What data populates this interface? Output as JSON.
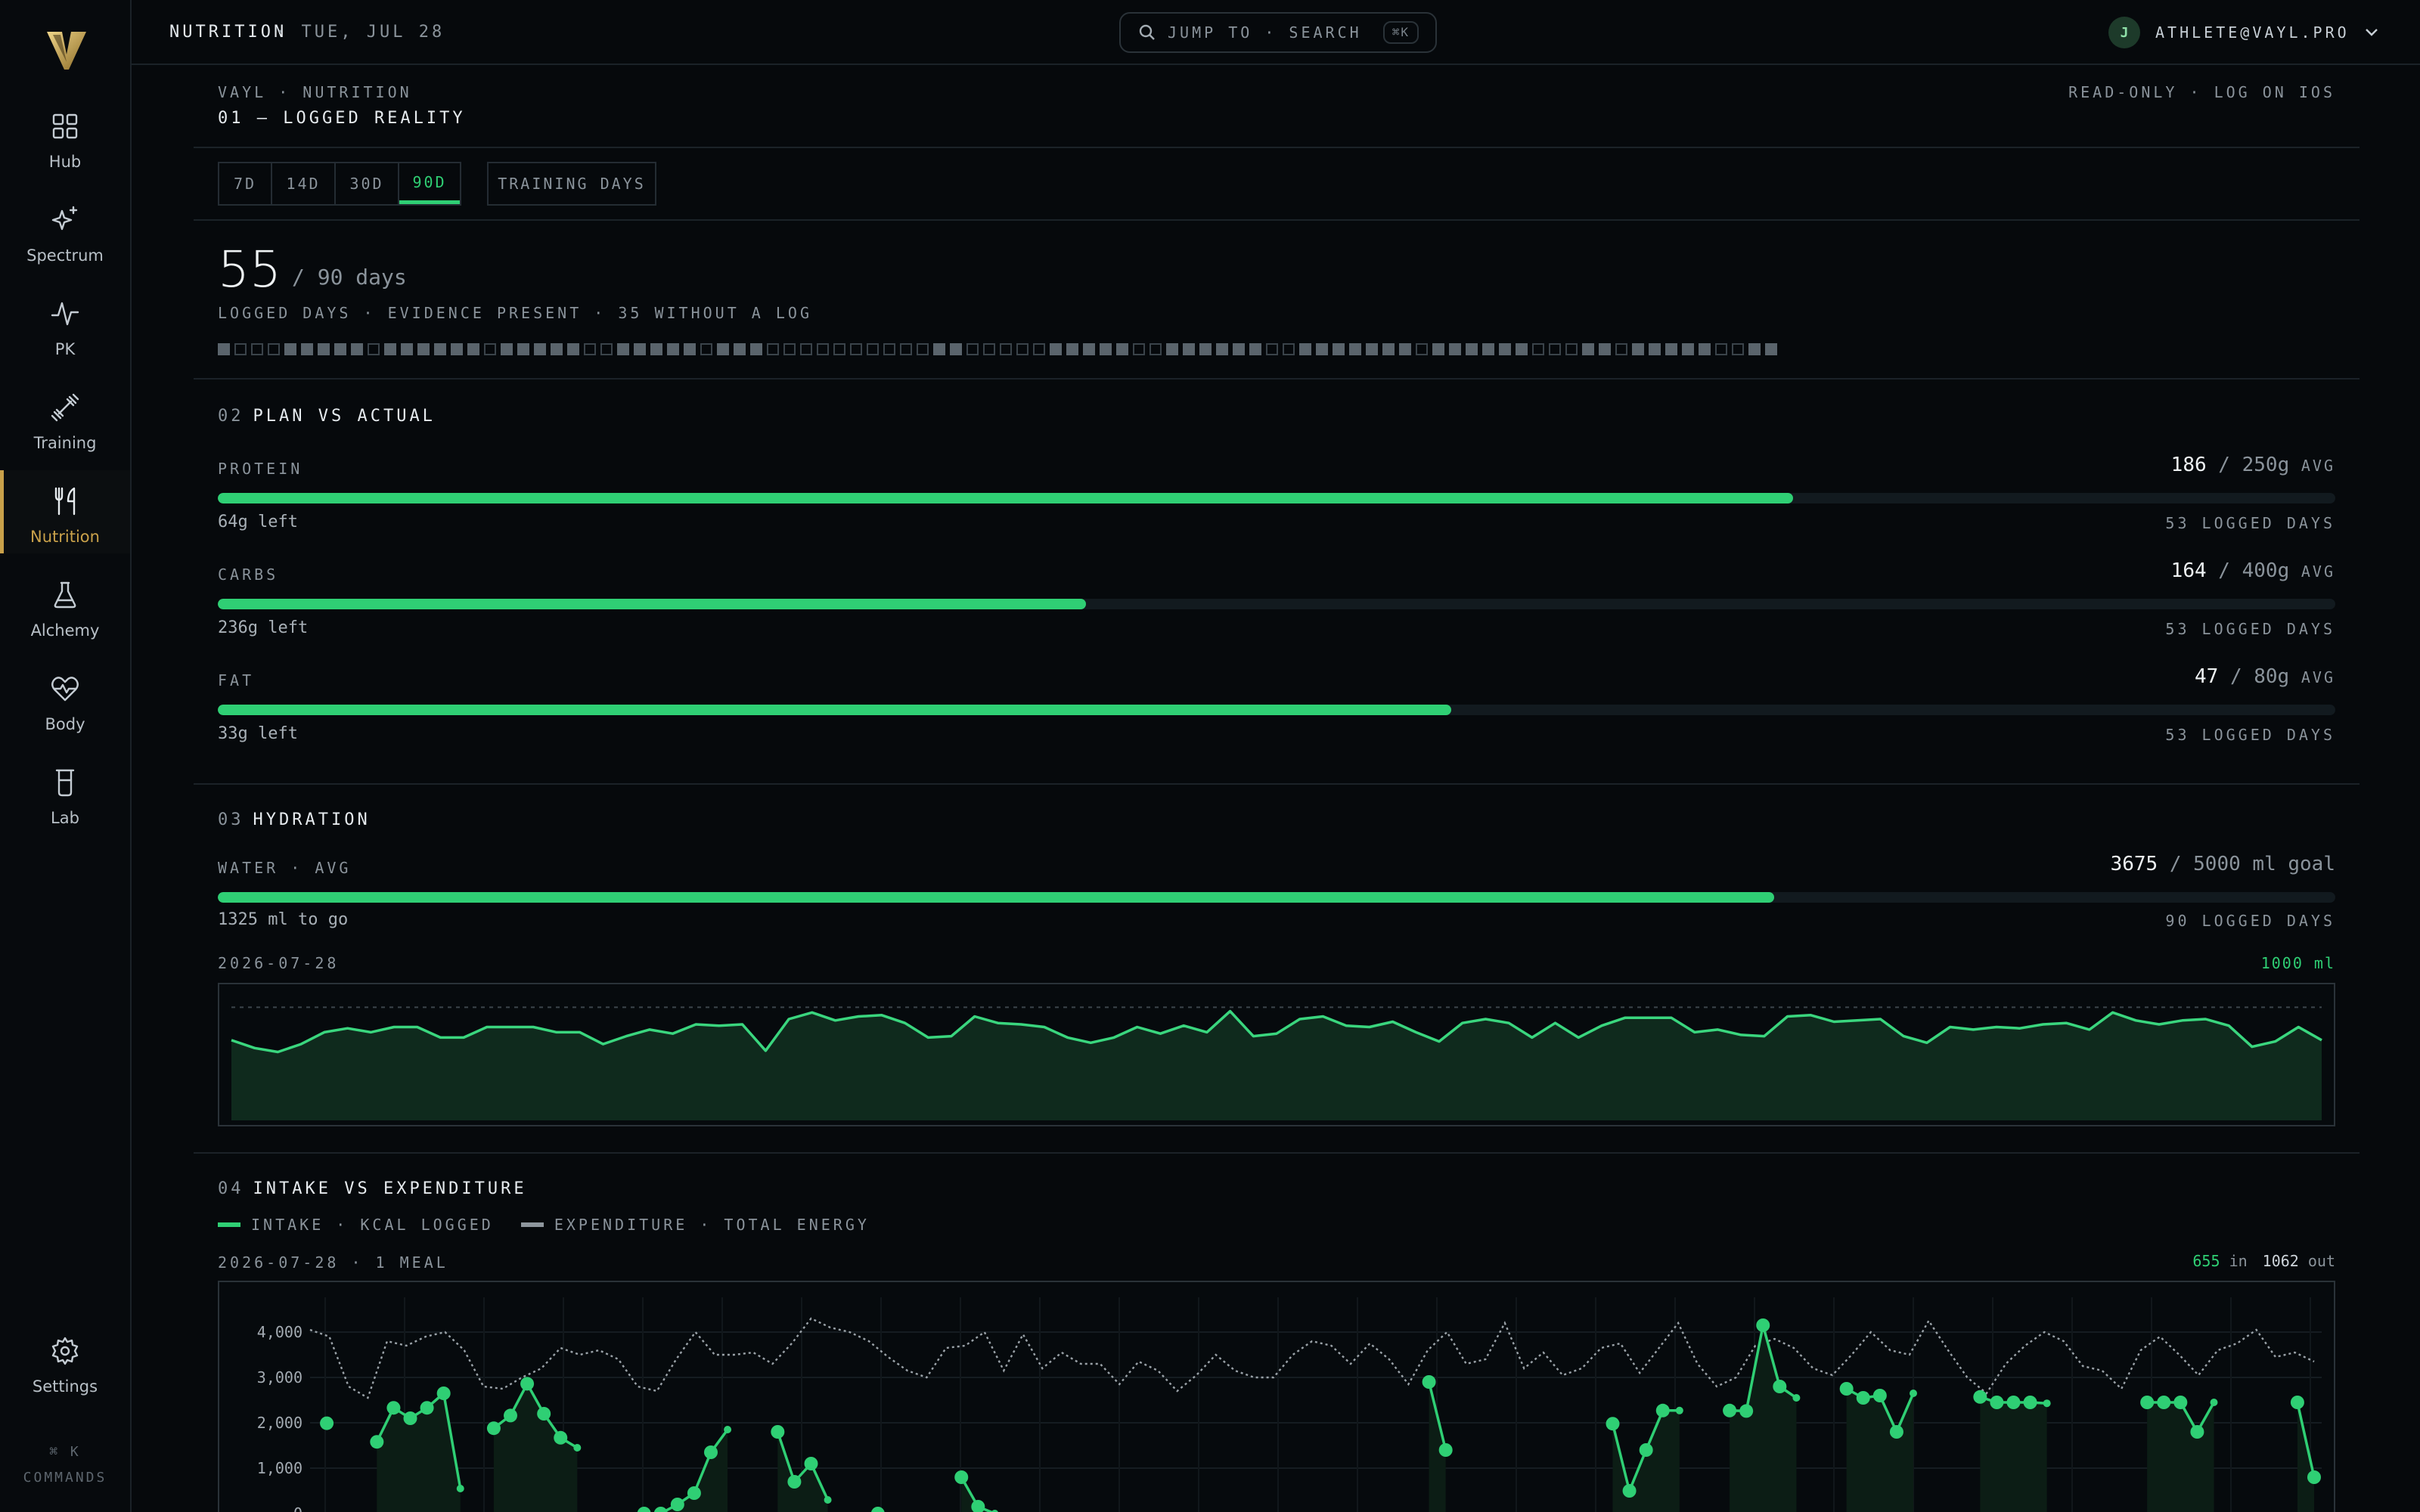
{
  "sidebar": {
    "logo": "V",
    "items": [
      {
        "label": "Hub",
        "icon": "grid-icon"
      },
      {
        "label": "Spectrum",
        "icon": "sparkle-icon"
      },
      {
        "label": "PK",
        "icon": "pulse-icon"
      },
      {
        "label": "Training",
        "icon": "dumbbell-icon"
      },
      {
        "label": "Nutrition",
        "icon": "utensils-icon",
        "active": true
      },
      {
        "label": "Alchemy",
        "icon": "flask-icon"
      },
      {
        "label": "Body",
        "icon": "heart-pulse-icon"
      },
      {
        "label": "Lab",
        "icon": "beaker-icon"
      }
    ],
    "settings_label": "Settings",
    "commands_key": "⌘ K",
    "commands_label": "COMMANDS"
  },
  "topbar": {
    "section": "NUTRITION",
    "date": "· TUE, JUL 28",
    "search_label": "JUMP TO · SEARCH",
    "search_kbd": "⌘K",
    "avatar_initial": "J",
    "email": "ATHLETE@VAYL.PRO"
  },
  "header": {
    "eyebrow": "VAYL · NUTRITION",
    "title": "01 — LOGGED REALITY",
    "readonly": "READ-ONLY · LOG ON IOS"
  },
  "range": {
    "options": [
      "7D",
      "14D",
      "30D",
      "90D"
    ],
    "selected": "90D",
    "training_label": "TRAINING DAYS"
  },
  "summary": {
    "logged": "55",
    "of": "/ 90 days",
    "caption": "LOGGED DAYS · EVIDENCE PRESENT · 35 WITHOUT A LOG",
    "days": [
      1,
      0,
      0,
      0,
      1,
      1,
      1,
      1,
      1,
      0,
      1,
      1,
      1,
      1,
      1,
      1,
      0,
      1,
      1,
      1,
      1,
      1,
      0,
      0,
      1,
      1,
      1,
      1,
      1,
      0,
      1,
      1,
      1,
      0,
      0,
      0,
      0,
      0,
      0,
      0,
      0,
      0,
      0,
      1,
      1,
      0,
      0,
      0,
      0,
      0,
      1,
      1,
      1,
      1,
      1,
      0,
      0,
      1,
      1,
      1,
      1,
      1,
      1,
      0,
      0,
      1,
      1,
      1,
      1,
      1,
      1,
      1,
      0,
      1,
      1,
      1,
      1,
      1,
      1,
      0,
      0,
      0,
      1,
      1,
      0,
      1,
      1,
      1,
      1,
      1,
      0,
      0,
      1,
      1
    ]
  },
  "plan": {
    "num": "02",
    "title": "PLAN VS ACTUAL",
    "macros": [
      {
        "label": "PROTEIN",
        "actual": "186",
        "target": "/ 250g",
        "unit": "AVG",
        "left": "64g left",
        "days": "53 LOGGED DAYS",
        "pct": 0.744
      },
      {
        "label": "CARBS",
        "actual": "164",
        "target": "/ 400g",
        "unit": "AVG",
        "left": "236g left",
        "days": "53 LOGGED DAYS",
        "pct": 0.41
      },
      {
        "label": "FAT",
        "actual": "47",
        "target": "/ 80g",
        "unit": "AVG",
        "left": "33g left",
        "days": "53 LOGGED DAYS",
        "pct": 0.5825
      }
    ]
  },
  "hydration": {
    "num": "03",
    "title": "HYDRATION",
    "label": "WATER · AVG",
    "actual": "3675",
    "target": "/ 5000 ml goal",
    "left": "1325 ml to go",
    "days": "90 LOGGED DAYS",
    "pct": 0.735,
    "chart_date": "2026-07-28",
    "chart_value": "1000 ml"
  },
  "energy": {
    "num": "04",
    "title": "INTAKE VS EXPENDITURE",
    "legend_intake": "INTAKE · KCAL LOGGED",
    "legend_exp": "EXPENDITURE · TOTAL ENERGY",
    "chart_date": "2026-07-28 · 1 MEAL",
    "in_val": "655",
    "in_label": "in",
    "out_val": "1062",
    "out_label": "out"
  },
  "colors": {
    "accent": "#2fcf74",
    "active_nav": "#c9a14a"
  },
  "chart_data": [
    {
      "type": "area",
      "title": "",
      "xlabel": "",
      "ylabel": "",
      "x_days": 90,
      "ylim": [
        0,
        5000
      ],
      "reference": 4300,
      "values": [
        3050,
        2750,
        2600,
        2900,
        3350,
        3500,
        3350,
        3550,
        3550,
        3150,
        3150,
        3550,
        3550,
        3550,
        3350,
        3350,
        2900,
        3200,
        3450,
        3300,
        3650,
        3600,
        3650,
        2650,
        3850,
        4100,
        3800,
        3950,
        4000,
        3700,
        3150,
        3200,
        3950,
        3700,
        3650,
        3550,
        3150,
        2950,
        3150,
        3550,
        3300,
        3600,
        3350,
        4150,
        3200,
        3300,
        3850,
        3950,
        3600,
        3550,
        3750,
        3350,
        3000,
        3700,
        3850,
        3700,
        3150,
        3700,
        3150,
        3600,
        3900,
        3900,
        3900,
        3350,
        3450,
        3250,
        3200,
        3950,
        4000,
        3750,
        3800,
        3850,
        3200,
        2950,
        3550,
        3450,
        3550,
        3500,
        3650,
        3700,
        3450,
        4100,
        3800,
        3650,
        3800,
        3850,
        3600,
        2800,
        3000,
        3550,
        3050
      ]
    },
    {
      "type": "line",
      "title": "",
      "ylabel": "",
      "xlabel": "",
      "yticks": [
        "4,000",
        "3,000",
        "2,000",
        "1,000",
        "0"
      ],
      "ylim": [
        0,
        4500
      ],
      "series": [
        {
          "name": "INTAKE · KCAL LOGGED",
          "values": [
            null,
            1990,
            null,
            null,
            1580,
            2330,
            2100,
            2330,
            2650,
            550,
            null,
            1880,
            2160,
            2860,
            2200,
            1670,
            1450,
            null,
            null,
            null,
            0,
            0,
            200,
            450,
            1350,
            1850,
            null,
            null,
            1800,
            700,
            1100,
            300,
            null,
            null,
            0,
            null,
            null,
            null,
            null,
            800,
            150,
            0,
            null,
            null,
            null,
            null,
            null,
            null,
            null,
            null,
            null,
            null,
            null,
            null,
            null,
            null,
            null,
            null,
            null,
            null,
            null,
            null,
            null,
            null,
            null,
            null,
            null,
            2900,
            1400,
            null,
            null,
            null,
            null,
            null,
            null,
            null,
            null,
            null,
            1980,
            500,
            1400,
            2270,
            2270,
            null,
            null,
            2270,
            2260,
            4150,
            2800,
            2550,
            null,
            null,
            2750,
            2550,
            2600,
            1800,
            2650,
            null,
            null,
            null,
            2570,
            2450,
            2450,
            2450,
            2430,
            null,
            null,
            null,
            null,
            null,
            2450,
            2450,
            2450,
            1800,
            2450,
            null,
            null,
            null,
            null,
            2450,
            800
          ]
        },
        {
          "name": "EXPENDITURE · TOTAL ENERGY",
          "values": [
            4050,
            3900,
            2800,
            2550,
            3800,
            3700,
            3900,
            4000,
            3600,
            2800,
            2750,
            3000,
            3200,
            3650,
            3500,
            3600,
            3400,
            2800,
            2700,
            3400,
            4000,
            3500,
            3500,
            3550,
            3300,
            3750,
            4300,
            4100,
            4000,
            3800,
            3450,
            3150,
            3000,
            3650,
            3700,
            4000,
            3150,
            3950,
            3200,
            3550,
            3300,
            3300,
            2850,
            3350,
            3150,
            2700,
            3050,
            3500,
            3150,
            3000,
            3000,
            3500,
            3800,
            3700,
            3300,
            3750,
            3400,
            2850,
            3600,
            4000,
            3300,
            3400,
            4200,
            3200,
            3550,
            3050,
            3200,
            3650,
            3750,
            3100,
            3650,
            4200,
            3300,
            2800,
            3000,
            3700,
            3850,
            3650,
            3200,
            3050,
            3500,
            4000,
            3600,
            3500,
            4250,
            3600,
            3000,
            2650,
            3300,
            3700,
            4000,
            3800,
            3250,
            3150,
            2750,
            3600,
            3900,
            3500,
            3050,
            3600,
            3750,
            4050,
            3450,
            3550,
            3350
          ]
        }
      ]
    }
  ]
}
